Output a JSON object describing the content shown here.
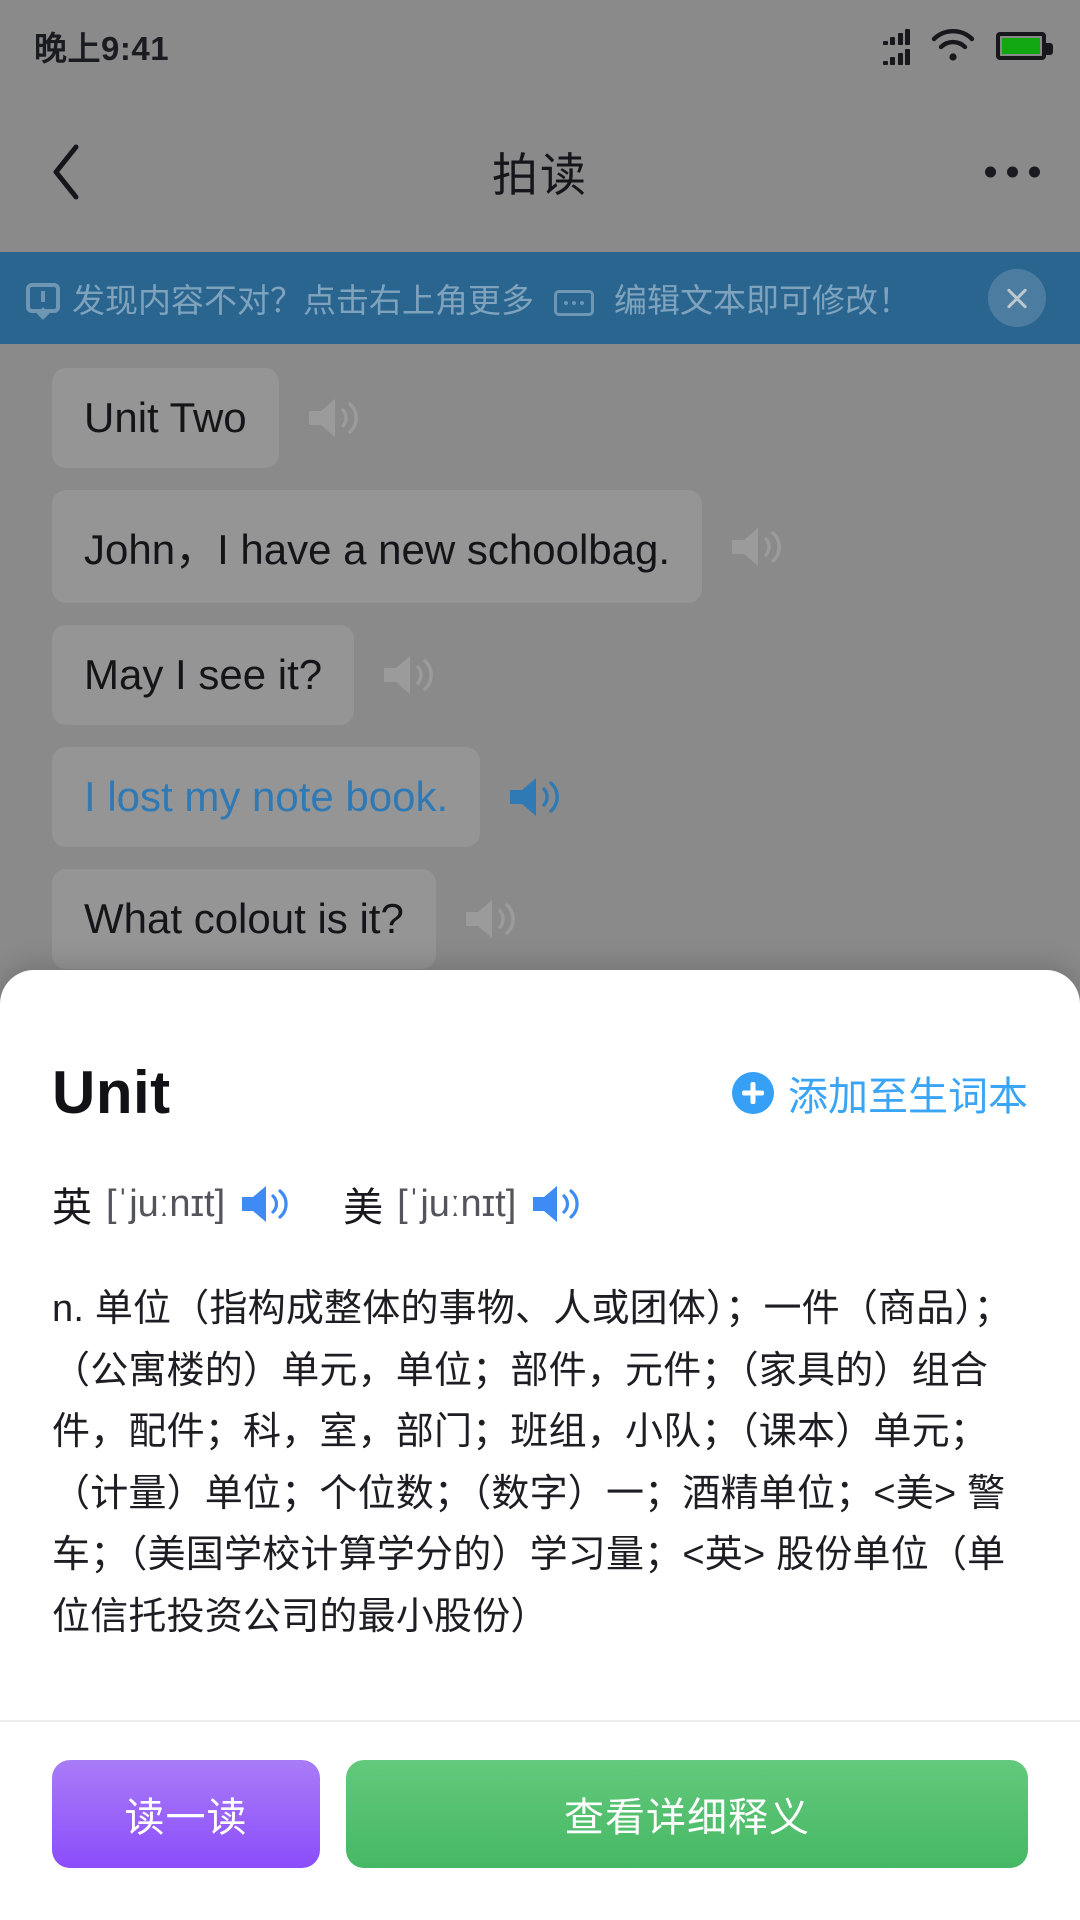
{
  "status_bar": {
    "time": "晚上9:41",
    "signal_icon": "signal-bars-icon",
    "wifi_icon": "wifi-icon",
    "battery_icon": "battery-icon",
    "battery_color": "#10a710"
  },
  "nav_bar": {
    "back_icon": "chevron-left-icon",
    "title": "拍读",
    "more_icon": "more-dots-icon"
  },
  "tip_banner": {
    "background_color": "#2a6590",
    "text_color": "#7fa3bd",
    "warn_icon": "warning-bubble-icon",
    "text_before": "发现内容不对？点击右上角更多",
    "dots_icon": "more-dots-icon",
    "text_after": "编辑文本即可修改！",
    "close_icon": "close-icon"
  },
  "sentences": [
    {
      "text": "Unit Two",
      "active": false,
      "speaker_icon": "speaker-icon"
    },
    {
      "text": "John，I have a new schoolbag.",
      "active": false,
      "speaker_icon": "speaker-icon"
    },
    {
      "text": "May I see it?",
      "active": false,
      "speaker_icon": "speaker-icon"
    },
    {
      "text": "I lost my note book.",
      "active": true,
      "speaker_icon": "speaker-icon"
    },
    {
      "text": "What colout is it?",
      "active": false,
      "speaker_icon": "speaker-icon"
    }
  ],
  "active_sentence_color": "#2f79b5",
  "sheet": {
    "word": "Unit",
    "add_wordbook_label": "添加至生词本",
    "add_wordbook_icon": "plus-circle-icon",
    "add_wordbook_color": "#3aa5f7",
    "phonetics": [
      {
        "lang": "英",
        "ipa": "[ˈjuːnɪt]",
        "speaker_icon": "speaker-icon"
      },
      {
        "lang": "美",
        "ipa": "[ˈjuːnɪt]",
        "speaker_icon": "speaker-icon"
      }
    ],
    "definition": "n. 单位（指构成整体的事物、人或团体）；一件（商品）；（公寓楼的）单元，单位；部件，元件；（家具的）组合件，配件；科，室，部门；班组，小队；（课本）单元；（计量）单位；个位数；（数字）一；酒精单位；<美> 警车；（美国学校计算学分的）学习量；<英> 股份单位（单位信托投资公司的最小股份）",
    "buttons": {
      "read_label": "读一读",
      "read_color": "#8b4dfb",
      "detail_label": "查看详细释义",
      "detail_color": "#46b863"
    }
  }
}
